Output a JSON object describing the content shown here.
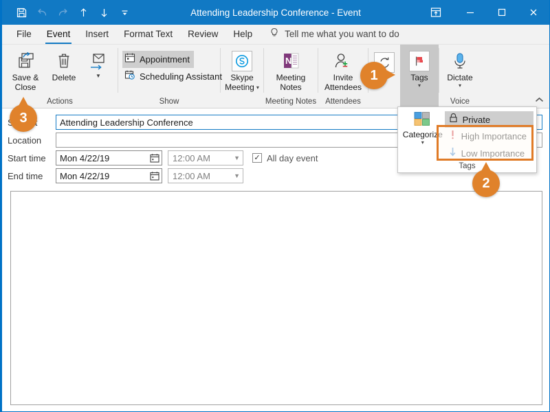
{
  "window": {
    "title": "Attending Leadership Conference  -  Event",
    "quick_access": [
      {
        "name": "save-icon",
        "label": "Save",
        "enabled": true
      },
      {
        "name": "undo-icon",
        "label": "Undo",
        "enabled": false
      },
      {
        "name": "redo-icon",
        "label": "Redo",
        "enabled": false
      },
      {
        "name": "previous-item-icon",
        "label": "Previous Item",
        "enabled": true
      },
      {
        "name": "next-item-icon",
        "label": "Next Item",
        "enabled": true
      },
      {
        "name": "customize-quick-access-toolbar-icon",
        "label": "Customize Quick Access Toolbar",
        "enabled": true
      }
    ],
    "controls": [
      {
        "name": "ribbon-display-options-icon",
        "label": "Ribbon Display Options"
      },
      {
        "name": "minimize-icon",
        "label": "Minimize"
      },
      {
        "name": "maximize-icon",
        "label": "Maximize"
      },
      {
        "name": "close-icon",
        "label": "Close"
      }
    ]
  },
  "tabs": [
    {
      "label": "File",
      "active": false
    },
    {
      "label": "Event",
      "active": true
    },
    {
      "label": "Insert",
      "active": false
    },
    {
      "label": "Format Text",
      "active": false
    },
    {
      "label": "Review",
      "active": false
    },
    {
      "label": "Help",
      "active": false
    }
  ],
  "tell_me": {
    "icon": "lightbulb-icon",
    "placeholder": "Tell me what you want to do"
  },
  "ribbon": {
    "groups": [
      {
        "label": "Actions",
        "buttons": [
          {
            "label_line1": "Save &",
            "label_line2": "Close",
            "icon": "save-and-close-icon"
          },
          {
            "label_line1": "Delete",
            "label_line2": "",
            "icon": "delete-trash-icon"
          },
          {
            "label_line1": "",
            "label_line2": "",
            "icon": "forward-arrow-icon"
          }
        ]
      },
      {
        "label": "Show",
        "items": [
          {
            "label": "Appointment",
            "icon": "appointment-calendar-icon",
            "selected": true
          },
          {
            "label": "Scheduling Assistant",
            "icon": "scheduling-assistant-icon",
            "selected": false
          }
        ]
      },
      {
        "label": "",
        "buttons": [
          {
            "label_line1": "Skype",
            "label_line2": "Meeting",
            "icon": "skype-icon",
            "has_caret": true
          }
        ]
      },
      {
        "label": "Meeting Notes",
        "buttons": [
          {
            "label_line1": "Meeting",
            "label_line2": "Notes",
            "icon": "onenote-icon"
          }
        ]
      },
      {
        "label": "Attendees",
        "buttons": [
          {
            "label_line1": "Invite",
            "label_line2": "Attendees",
            "icon": "invite-attendees-icon"
          }
        ]
      },
      {
        "label": "",
        "buttons": [
          {
            "label_line1": "",
            "label_line2": "",
            "icon": "recurrence-icon"
          }
        ]
      },
      {
        "label": "",
        "highlighted": true,
        "buttons": [
          {
            "label_line1": "Tags",
            "label_line2": "",
            "icon": "tags-flag-icon",
            "has_caret": true
          }
        ]
      },
      {
        "label": "Voice",
        "buttons": [
          {
            "label_line1": "Dictate",
            "label_line2": "",
            "icon": "microphone-icon",
            "has_caret": true
          }
        ]
      }
    ],
    "collapse_label": "Collapse the Ribbon"
  },
  "tags_dropdown": {
    "group_label": "Tags",
    "categorize": {
      "label": "Categorize",
      "icon": "categorize-squares-icon"
    },
    "items": [
      {
        "label": "Private",
        "icon": "lock-icon",
        "selected": true,
        "highlighted": false
      },
      {
        "label": "High Importance",
        "icon": "exclamation-icon",
        "selected": false,
        "highlighted": true
      },
      {
        "label": "Low Importance",
        "icon": "down-arrow-icon",
        "selected": false,
        "highlighted": true
      }
    ]
  },
  "form": {
    "subject": {
      "label": "Subject",
      "value": "Attending Leadership Conference"
    },
    "location": {
      "label": "Location",
      "value": ""
    },
    "start_time": {
      "label": "Start time",
      "date": "Mon 4/22/19",
      "time": "12:00 AM"
    },
    "end_time": {
      "label": "End time",
      "date": "Mon 4/22/19",
      "time": "12:00 AM"
    },
    "all_day": {
      "label": "All day event",
      "checked": true,
      "check_glyph": "✓"
    },
    "calendar_icon": "calendar-picker-icon",
    "dropdown_icon": "chevron-down-icon"
  },
  "notes": {
    "value": ""
  },
  "callouts": [
    {
      "number": "1",
      "direction": "right",
      "target": "tags-button"
    },
    {
      "number": "2",
      "direction": "up",
      "target": "importance-menu-items"
    },
    {
      "number": "3",
      "direction": "up",
      "target": "save-and-close-button"
    }
  ],
  "colors": {
    "title_bar": "#1179c4",
    "accent": "#1179c4",
    "callout_orange": "#e0822b",
    "highlight_border": "#e07b27",
    "ribbon_bg": "#f2f2f2",
    "tags_group_bg": "#c8c8c8",
    "selected_item_bg": "#cecece"
  }
}
